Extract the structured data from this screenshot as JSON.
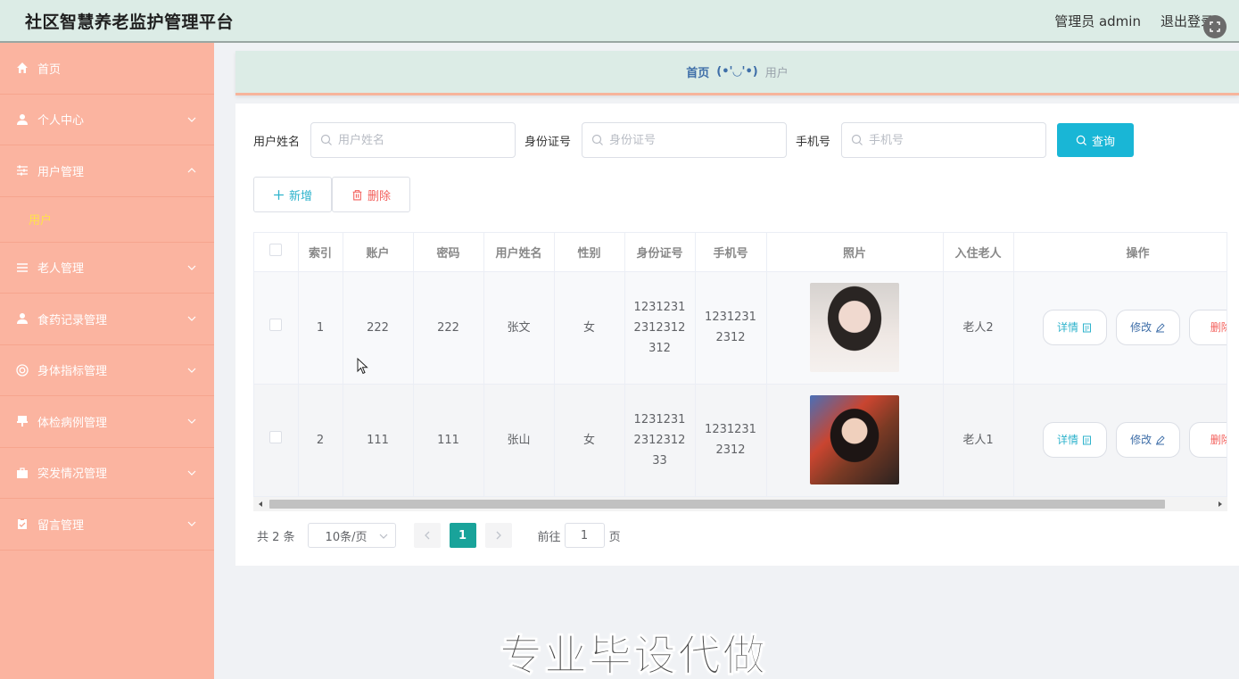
{
  "header": {
    "title": "社区智慧养老监护管理平台",
    "user_label": "管理员 admin",
    "logout_label": "退出登录"
  },
  "sidebar": {
    "items": [
      {
        "label": "首页",
        "icon": "home-icon"
      },
      {
        "label": "个人中心",
        "icon": "user-icon"
      },
      {
        "label": "用户管理",
        "icon": "sliders-icon"
      },
      {
        "label": "用户",
        "icon": ""
      },
      {
        "label": "老人管理",
        "icon": "list-icon"
      },
      {
        "label": "食药记录管理",
        "icon": "user-icon"
      },
      {
        "label": "身体指标管理",
        "icon": "lifebuoy-icon"
      },
      {
        "label": "体检病例管理",
        "icon": "stamp-icon"
      },
      {
        "label": "突发情况管理",
        "icon": "briefcase-icon"
      },
      {
        "label": "留言管理",
        "icon": "clipboard-icon"
      }
    ]
  },
  "breadcrumb": {
    "home": "首页",
    "separator": "(•'◡'•)",
    "current": "用户"
  },
  "search": {
    "name_label": "用户姓名",
    "name_placeholder": "用户姓名",
    "id_label": "身份证号",
    "id_placeholder": "身份证号",
    "phone_label": "手机号",
    "phone_placeholder": "手机号",
    "query_label": "查询"
  },
  "actions": {
    "add_label": "新增",
    "delete_label": "删除"
  },
  "table": {
    "columns": [
      "索引",
      "账户",
      "密码",
      "用户姓名",
      "性别",
      "身份证号",
      "手机号",
      "照片",
      "入住老人",
      "操作"
    ],
    "rows": [
      {
        "index": "1",
        "account": "222",
        "password": "222",
        "name": "张文",
        "gender": "女",
        "id_card": "12312312312312312",
        "phone": "12312312312",
        "elder": "老人2"
      },
      {
        "index": "2",
        "account": "111",
        "password": "111",
        "name": "张山",
        "gender": "女",
        "id_card": "1231231231231233",
        "phone": "12312312312",
        "elder": "老人1"
      }
    ],
    "detail_label": "详情",
    "edit_label": "修改",
    "delete_label": "删除"
  },
  "pagination": {
    "total": "共 2 条",
    "page_size": "10条/页",
    "current_page": "1",
    "goto_label": "前往",
    "goto_value": "1",
    "page_suffix": "页"
  },
  "watermark": "专业毕设代做",
  "colors": {
    "sidebar_bg": "#fbb4a0",
    "header_bg": "#dcece6",
    "accent": "#19b6d6",
    "page_active": "#19a39a",
    "submenu_active": "#ffe24a",
    "danger": "#f3605c"
  }
}
